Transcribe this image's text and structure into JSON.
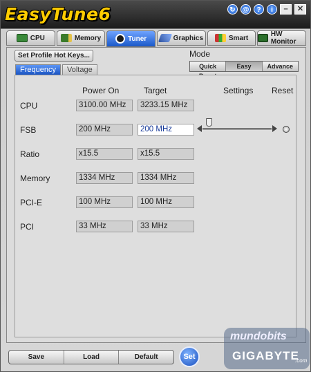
{
  "app": {
    "title": "EasyTune6"
  },
  "titlebar_icons": [
    {
      "name": "update-icon",
      "glyph": "↻"
    },
    {
      "name": "email-icon",
      "glyph": "@"
    },
    {
      "name": "help-icon",
      "glyph": "?"
    },
    {
      "name": "info-icon",
      "glyph": "i"
    },
    {
      "name": "minimize-icon",
      "glyph": "–"
    },
    {
      "name": "close-icon",
      "glyph": "✕"
    }
  ],
  "main_tabs": [
    {
      "label": "CPU",
      "icon": "cpu-chip-icon",
      "active": false
    },
    {
      "label": "Memory",
      "icon": "memory-stick-icon",
      "active": false
    },
    {
      "label": "Tuner",
      "icon": "tuner-icon",
      "active": true
    },
    {
      "label": "Graphics",
      "icon": "graphics-card-icon",
      "active": false
    },
    {
      "label": "Smart",
      "icon": "smart-fan-icon",
      "active": false
    },
    {
      "label": "HW Monitor",
      "icon": "hw-monitor-icon",
      "active": false
    }
  ],
  "profile": {
    "hotkeys_label": "Set Profile Hot Keys..."
  },
  "mode": {
    "label": "Mode",
    "options": [
      "Quick Boost",
      "Easy",
      "Advance"
    ],
    "selected": "Easy"
  },
  "sub_tabs": [
    {
      "label": "Frequency",
      "active": true
    },
    {
      "label": "Voltage",
      "active": false
    }
  ],
  "columns": {
    "power_on": "Power On",
    "target": "Target",
    "settings": "Settings",
    "reset": "Reset"
  },
  "rows": [
    {
      "label": "CPU",
      "power_on": "3100.00 MHz",
      "target": "3233.15 MHz"
    },
    {
      "label": "FSB",
      "power_on": "200 MHz",
      "target": "200 MHz"
    },
    {
      "label": "Ratio",
      "power_on": "x15.5",
      "target": "x15.5"
    },
    {
      "label": "Memory",
      "power_on": "1334 MHz",
      "target": "1334 MHz"
    },
    {
      "label": "PCI-E",
      "power_on": "100 MHz",
      "target": "100 MHz"
    },
    {
      "label": "PCI",
      "power_on": "33 MHz",
      "target": "33 MHz"
    }
  ],
  "fsb_slider": {
    "level": 0.05
  },
  "bottom_buttons": {
    "save": "Save",
    "load": "Load",
    "default": "Default",
    "set": "Set"
  },
  "watermark": {
    "site": "mundobits",
    "brand": "GIGABYTE",
    "tld": ".com"
  },
  "colors": {
    "accent": "#1b59c9",
    "logo": "#ffcc00",
    "editable_text": "#1a3c9a"
  }
}
